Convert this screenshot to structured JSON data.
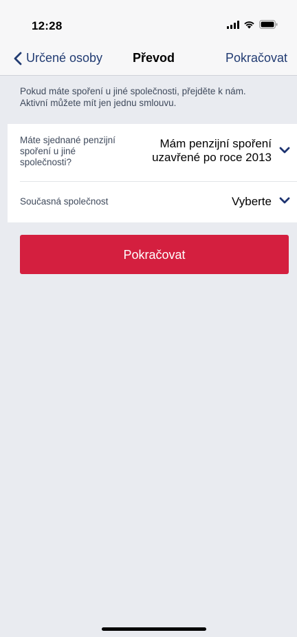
{
  "status_bar": {
    "time": "12:28",
    "icons": [
      "signal-icon",
      "wifi-icon",
      "battery-icon"
    ]
  },
  "nav": {
    "back_label": "Určené osoby",
    "title": "Převod",
    "action_label": "Pokračovat"
  },
  "info": {
    "line1": "Pokud máte spoření u jiné společnosti, přejděte k nám.",
    "line2": "Aktivní můžete mít jen jednu smlouvu."
  },
  "form": {
    "existing_savings": {
      "label_line1": "Máte sjednané penzijní",
      "label_line2": "spoření u jiné",
      "label_line3": "společnosti?",
      "value_line1": "Mám penzijní spoření",
      "value_line2": "uzavřené po roce 2013"
    },
    "current_company": {
      "label": "Současná společnost",
      "value": "Vyberte"
    }
  },
  "primary_button": {
    "label": "Pokračovat"
  },
  "colors": {
    "accent_blue": "#213b72",
    "button_red": "#d41f3f",
    "background": "#e9ebf0",
    "chevron": "#1d3370"
  }
}
